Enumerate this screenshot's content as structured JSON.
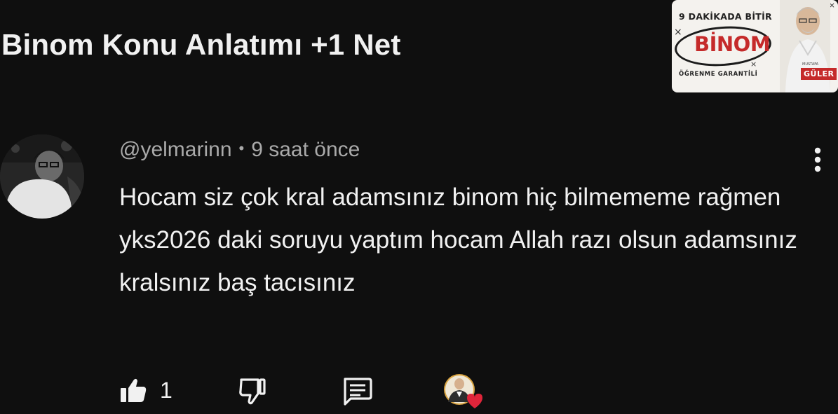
{
  "video": {
    "title": "Binom Konu Anlatımı +1 Net",
    "thumbnail": {
      "top_text": "9 DAKİKADA BİTİR",
      "main_text": "BİNOM",
      "bottom_text": "ÖĞRENME GARANTİLİ",
      "small_text": "MUSTAFA",
      "badge_text": "GÜLER"
    }
  },
  "comment": {
    "username": "@yelmarinn",
    "separator": "•",
    "time": "9 saat önce",
    "text": "Hocam siz çok kral adamsınız binom hiç bilmememe rağmen yks2026 daki soruyu yaptım hocam Allah razı olsun adamsınız kralsınız baş tacısınız",
    "like_count": "1"
  },
  "colors": {
    "background": "#0f0f0f",
    "text_primary": "#f1f1f1",
    "text_secondary": "#aaaaaa",
    "heart": "#e0253a",
    "thumbnail_accent": "#c52a2a"
  },
  "icons": {
    "like": "thumbs-up-icon",
    "dislike": "thumbs-down-icon",
    "reply": "comment-reply-icon",
    "more": "vertical-dots-icon",
    "creator_heart": "creator-heart-icon"
  }
}
